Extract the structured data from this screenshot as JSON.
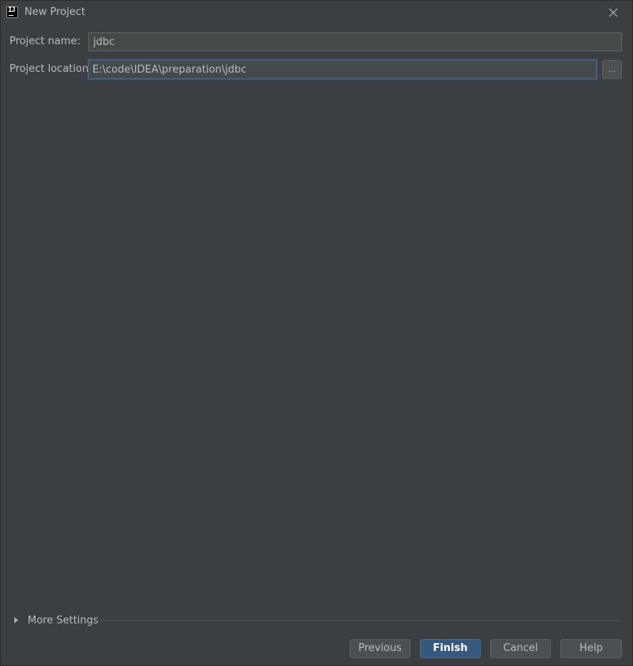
{
  "window": {
    "title": "New Project",
    "app_icon_text": "IJ"
  },
  "form": {
    "project_name_label": "Project name:",
    "project_name_value": "jdbc",
    "project_location_label": "Project location:",
    "project_location_value": "E:\\code\\IDEA\\preparation\\jdbc",
    "browse_label": "..."
  },
  "more_settings": {
    "label": "More Settings",
    "expanded": false
  },
  "buttons": {
    "previous": "Previous",
    "finish": "Finish",
    "cancel": "Cancel",
    "help": "Help"
  },
  "colors": {
    "background": "#3c3f41",
    "field_background": "#45494a",
    "focus_border": "#3d6185",
    "primary_button": "#365880"
  }
}
